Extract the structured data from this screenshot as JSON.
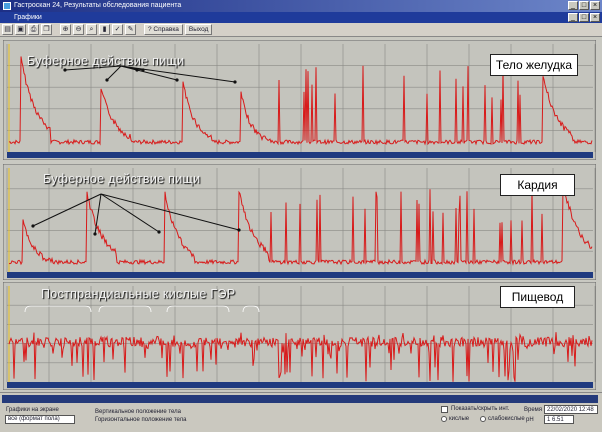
{
  "window": {
    "title": "Гастроскан 24, Результаты обследования пациента",
    "subtitle": "Графики",
    "controls": [
      "_",
      "□",
      "×"
    ]
  },
  "toolbar": {
    "buttons": [
      "icon-open",
      "icon-save",
      "icon-print",
      "icon-copy",
      "icon-zoom-in",
      "icon-zoom-out",
      "icon-zoom",
      "icon-marker",
      "icon-check",
      "icon-edit"
    ],
    "help_label": "? Справка",
    "exit_label": "Выход"
  },
  "panels": [
    {
      "annotation": "Буферное действие пищи",
      "label": "Тело желудка"
    },
    {
      "annotation": "Буферное действие пищи",
      "label": "Кардия"
    },
    {
      "annotation": "Постпрандиальные кислые ГЭР",
      "label": "Пищевод"
    }
  ],
  "statusbar": {
    "mode_label": "Графики на экране",
    "mode_value": "все (формат пола)",
    "legend_line1": "Вертикальное положение тела",
    "legend_line2": "Горизонтальное положение тела",
    "checkbox_label": "Показать/скрыть инт.",
    "radio1": "кислые",
    "radio2": "слабокислые",
    "time_label": "Время",
    "date_value": "22/02/2020 12:48",
    "ph_label": "pH",
    "ph_value": "1 6.51"
  },
  "colors": {
    "trace": "#d81a1a",
    "panel_bg": "#c4c4bd",
    "grid": "#8a8a86"
  }
}
